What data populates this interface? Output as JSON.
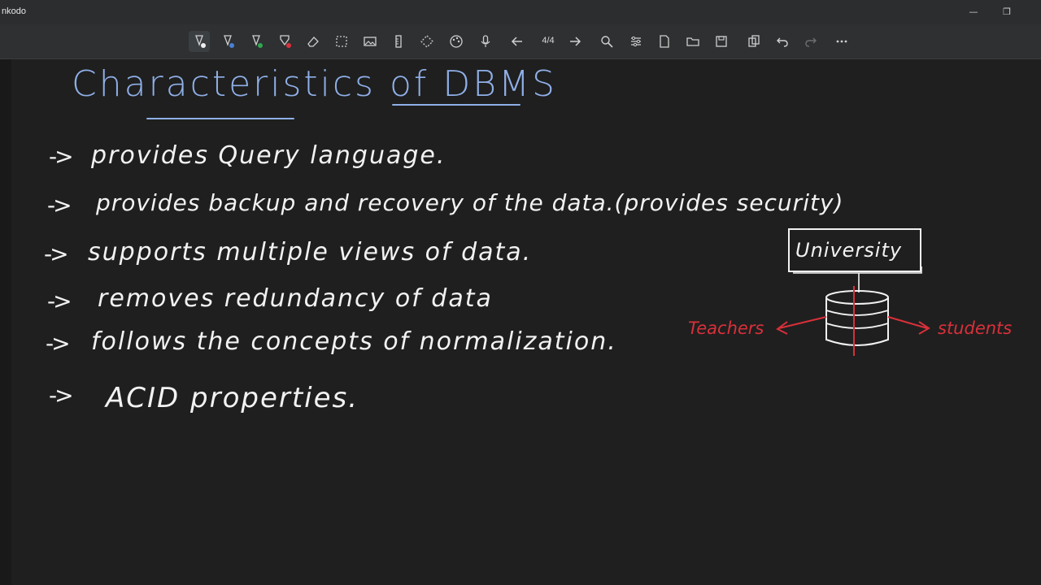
{
  "window": {
    "app_title": "nkodo",
    "minimize_glyph": "—",
    "maximize_glyph": "❐"
  },
  "toolbar": {
    "page_indicator": "4/4",
    "tools": [
      "pen-black-icon",
      "pen-blue-icon",
      "pen-green-icon",
      "pen-red-icon",
      "eraser-icon",
      "select-rect-icon",
      "insert-image-icon",
      "ruler-icon",
      "lasso-icon",
      "color-palette-icon",
      "microphone-icon",
      "previous-page-icon",
      "next-page-icon",
      "zoom-icon",
      "settings-icon",
      "new-page-icon",
      "open-folder-icon",
      "save-icon",
      "copy-icon",
      "undo-icon",
      "redo-icon",
      "more-icon"
    ],
    "colors": {
      "blue": "#4a7fd4",
      "green": "#2fa84f",
      "red": "#d9303a"
    }
  },
  "notes": {
    "title": "Characteristics of DBMS",
    "bullets": [
      {
        "arrow": "->",
        "text": "provides Query language."
      },
      {
        "arrow": "->",
        "text": "provides backup and recovery of the data.(provides security)"
      },
      {
        "arrow": "->",
        "text": "supports multiple views of data."
      },
      {
        "arrow": "->",
        "text": "removes redundancy of data"
      },
      {
        "arrow": "->",
        "text": "follows the concepts of normalization."
      },
      {
        "arrow": "->",
        "text": "ACID properties."
      }
    ],
    "text_color": "#f2f2f2",
    "title_color": "#8fb0e8"
  },
  "diagram": {
    "box_label": "University",
    "left_label": "Teachers",
    "right_label": "students",
    "accent_color": "#d9303a"
  }
}
